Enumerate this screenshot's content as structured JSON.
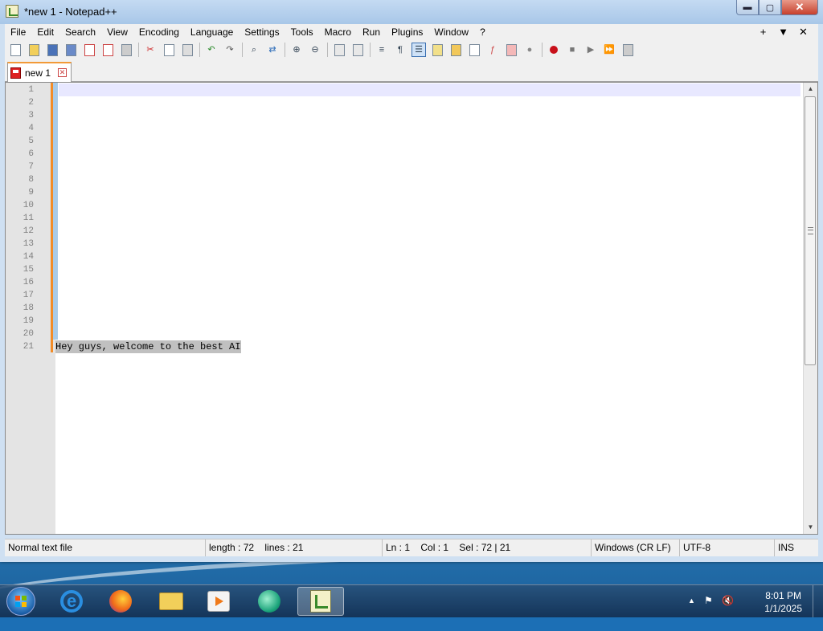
{
  "window": {
    "title": "*new 1 - Notepad++",
    "controls": {
      "minimize": "▬",
      "maximize": "▢",
      "close": "✕"
    }
  },
  "menu": {
    "items": [
      "File",
      "Edit",
      "Search",
      "View",
      "Encoding",
      "Language",
      "Settings",
      "Tools",
      "Macro",
      "Run",
      "Plugins",
      "Window",
      "?"
    ],
    "right": {
      "add": "+",
      "list": "▼",
      "close": "✕"
    }
  },
  "toolbar": {
    "icons": [
      "new-file",
      "open-file",
      "save",
      "save-all",
      "close",
      "close-all",
      "print",
      "cut",
      "copy",
      "paste",
      "undo",
      "redo",
      "find",
      "replace",
      "zoom-in",
      "zoom-out",
      "sync-vertical",
      "sync-horizontal",
      "word-wrap",
      "show-all-chars",
      "indent-guide",
      "user-language",
      "document-map",
      "function-list",
      "folder-as-workspace",
      "monitoring",
      "record-macro",
      "stop-recording",
      "playback",
      "run-macro-multiple",
      "save-macro"
    ]
  },
  "tab": {
    "label": "new 1",
    "close": "✕"
  },
  "editor": {
    "line_numbers": [
      "1",
      "2",
      "3",
      "4",
      "5",
      "6",
      "7",
      "8",
      "9",
      "10",
      "11",
      "12",
      "13",
      "14",
      "15",
      "16",
      "17",
      "18",
      "19",
      "20",
      "21"
    ],
    "last_line_text": "Hey guys, welcome to the best AI"
  },
  "status": {
    "file_type": "Normal text file",
    "length": "length : 72",
    "lines": "lines : 21",
    "ln": "Ln : 1",
    "col": "Col : 1",
    "sel": "Sel : 72 | 21",
    "eol": "Windows (CR LF)",
    "encoding": "UTF-8",
    "mode": "INS"
  },
  "taskbar": {
    "apps": [
      "internet-explorer",
      "firefox",
      "file-explorer",
      "media-player",
      "green-app",
      "notepad-plus-plus"
    ],
    "clock": {
      "time": "8:01 PM",
      "date": "1/1/2025"
    },
    "tray": {
      "show_hidden": "▲",
      "flag": "⚑",
      "volume": "🔇"
    }
  }
}
